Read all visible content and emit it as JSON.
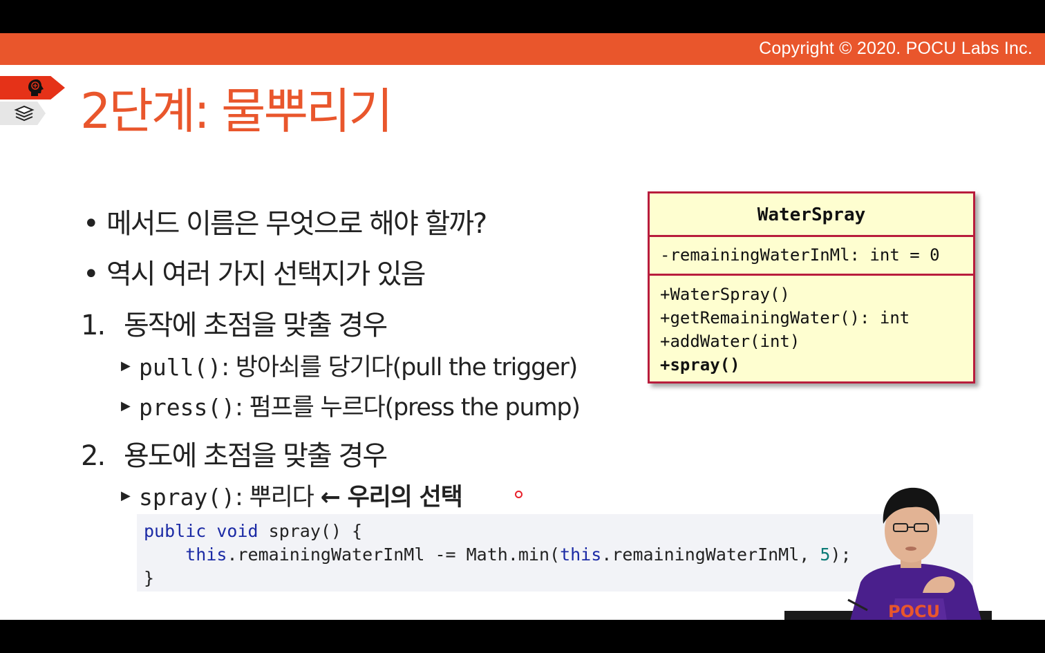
{
  "header": {
    "copyright": "Copyright © 2020. POCU Labs Inc."
  },
  "nav": {
    "tab_icons": [
      "brain-head-icon",
      "book-stack-icon"
    ]
  },
  "slide": {
    "title": "2단계: 물뿌리기",
    "bullets": [
      {
        "marker": "•",
        "text": "메서드 이름은 무엇으로 해야 할까?"
      },
      {
        "marker": "•",
        "text": "역시 여러 가지 선택지가 있음"
      }
    ],
    "options": [
      {
        "number": "1.",
        "text": "동작에 초점을 맞출 경우",
        "subs": [
          {
            "code": "pull()",
            "desc": ": 방아쇠를 당기다(pull the trigger)"
          },
          {
            "code": "press()",
            "desc": ": 펌프를 누르다(press the pump)"
          }
        ]
      },
      {
        "number": "2.",
        "text": "용도에 초점을 맞출 경우",
        "subs": [
          {
            "code": "spray()",
            "desc": ": 뿌리다 ",
            "emphasis": "← 우리의 선택"
          }
        ]
      }
    ]
  },
  "uml": {
    "class_name": "WaterSpray",
    "attributes": [
      "-remainingWaterInMl: int = 0"
    ],
    "operations": [
      "+WaterSpray()",
      "+getRemainingWater(): int",
      "+addWater(int)"
    ],
    "highlighted_operation": "+spray()"
  },
  "code": {
    "line1": {
      "kw1": "public",
      "kw2": "void",
      "rest": " spray() {"
    },
    "line2": {
      "indent": "    ",
      "this1": "this",
      "mid": ".remainingWaterInMl -= Math.min(",
      "this2": "this",
      "tail": ".remainingWaterInMl, ",
      "num": "5",
      "end": ");"
    },
    "line3": "}"
  },
  "colors": {
    "accent": "#e9562c",
    "uml_border": "#b81c3c",
    "uml_fill": "#fefed0",
    "code_keyword": "#1b2aa5"
  }
}
